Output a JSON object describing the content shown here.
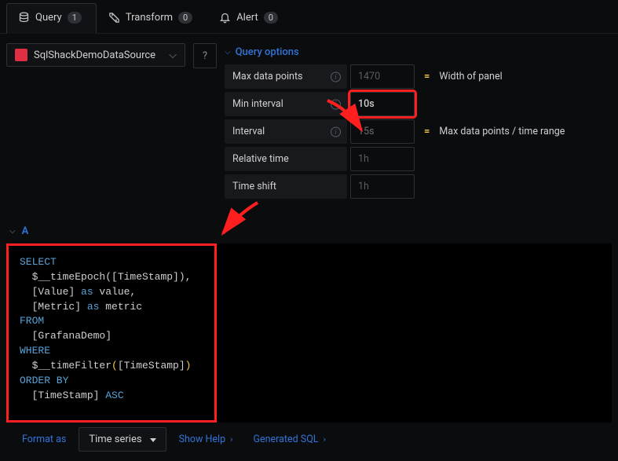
{
  "tabs": {
    "query": {
      "label": "Query",
      "count": "1"
    },
    "transform": {
      "label": "Transform",
      "count": "0"
    },
    "alert": {
      "label": "Alert",
      "count": "0"
    }
  },
  "datasource": {
    "name": "SqlShackDemoDataSource"
  },
  "query_options": {
    "header": "Query options",
    "rows": {
      "max_data_points": {
        "label": "Max data points",
        "placeholder": "1470",
        "rhs": "Width of panel"
      },
      "min_interval": {
        "label": "Min interval",
        "value": "10s"
      },
      "interval": {
        "label": "Interval",
        "value": "15s",
        "rhs": "Max data points / time range"
      },
      "relative_time": {
        "label": "Relative time",
        "placeholder": "1h"
      },
      "time_shift": {
        "label": "Time shift",
        "placeholder": "1h"
      }
    }
  },
  "query": {
    "letter": "A",
    "sql": {
      "l1": "SELECT",
      "l2a": "  $__timeEpoch",
      "l2b": "[TimeStamp]",
      "l2c": ",",
      "l3a": "  [Value] ",
      "l3kw": "as",
      "l3b": " value,",
      "l4a": "  [Metric] ",
      "l4kw": "as",
      "l4b": " metric",
      "l5": "FROM",
      "l6": "  [GrafanaDemo]",
      "l7": "WHERE",
      "l8a": "  $__timeFilter",
      "l8b": "[TimeStamp]",
      "l9": "ORDER BY",
      "l10a": "  [TimeStamp] ",
      "l10kw": "ASC"
    }
  },
  "bottom": {
    "format_as": "Format as",
    "format_value": "Time series",
    "show_help": "Show Help",
    "generated_sql": "Generated SQL"
  }
}
